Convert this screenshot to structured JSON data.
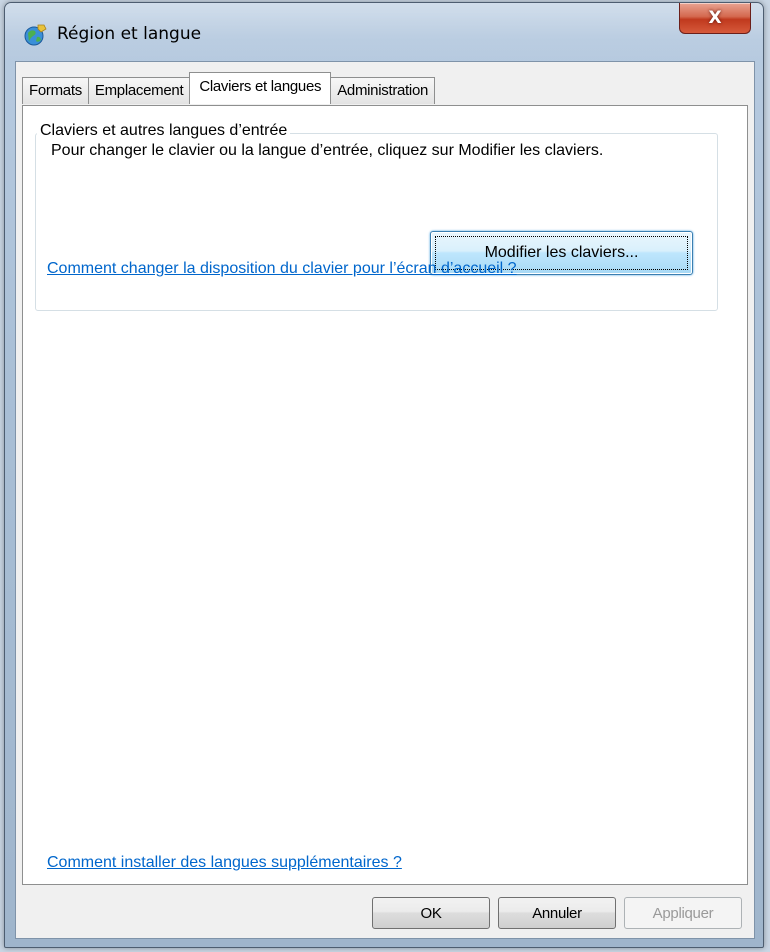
{
  "window": {
    "title": "Région et langue",
    "close_glyph": "X"
  },
  "tabs": [
    {
      "label": "Formats"
    },
    {
      "label": "Emplacement"
    },
    {
      "label": "Claviers et langues"
    },
    {
      "label": "Administration"
    }
  ],
  "active_tab": "Claviers et langues",
  "keyboards_group": {
    "legend": "Claviers et autres langues d’entrée",
    "description": "Pour changer le clavier ou la langue d’entrée, cliquez sur Modifier les claviers.",
    "modify_button": "Modifier les claviers...",
    "welcome_link": "Comment changer la disposition du clavier pour l’écran d’accueil ?"
  },
  "install_link": "Comment installer des langues supplémentaires ?",
  "buttons": {
    "ok": "OK",
    "cancel": "Annuler",
    "apply": "Appliquer"
  },
  "icons": {
    "title": "globe-icon",
    "close": "close-icon"
  },
  "colors": {
    "link": "#0066cc",
    "close_button": "#c0391e",
    "focused_button_border": "#3c7fb1"
  }
}
